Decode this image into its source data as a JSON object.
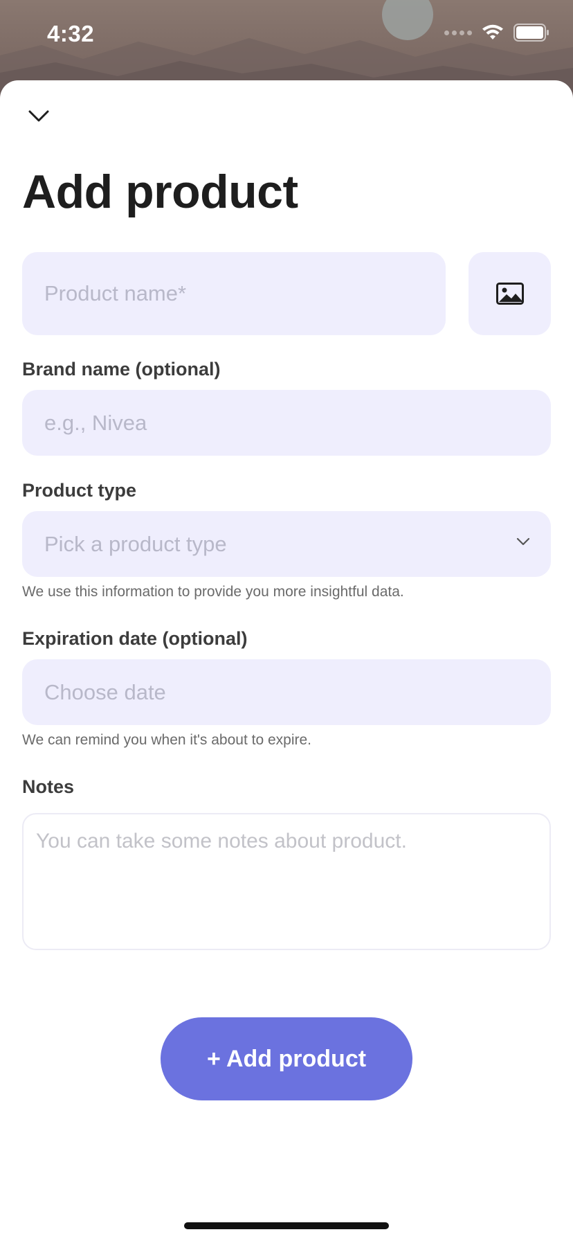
{
  "status_bar": {
    "time": "4:32"
  },
  "header": {
    "title": "Add product"
  },
  "form": {
    "product_name": {
      "placeholder": "Product name*"
    },
    "brand": {
      "label": "Brand name (optional)",
      "placeholder": "e.g., Nivea"
    },
    "product_type": {
      "label": "Product type",
      "placeholder": "Pick a product type",
      "helper": "We use this information to provide you more insightful data."
    },
    "expiration": {
      "label": "Expiration date (optional)",
      "placeholder": "Choose date",
      "helper": "We can remind you when it's about to expire."
    },
    "notes": {
      "label": "Notes",
      "placeholder": "You can take some notes about product."
    }
  },
  "actions": {
    "add_label": "+ Add product"
  },
  "colors": {
    "accent": "#6b72df",
    "field_bg": "#efeefd",
    "placeholder": "#b8b8c9"
  },
  "icons": {
    "dismiss": "chevron-down-icon",
    "image": "image-icon",
    "dropdown": "chevron-down-icon",
    "wifi": "wifi-icon",
    "battery": "battery-icon",
    "signal": "signal-icon"
  }
}
